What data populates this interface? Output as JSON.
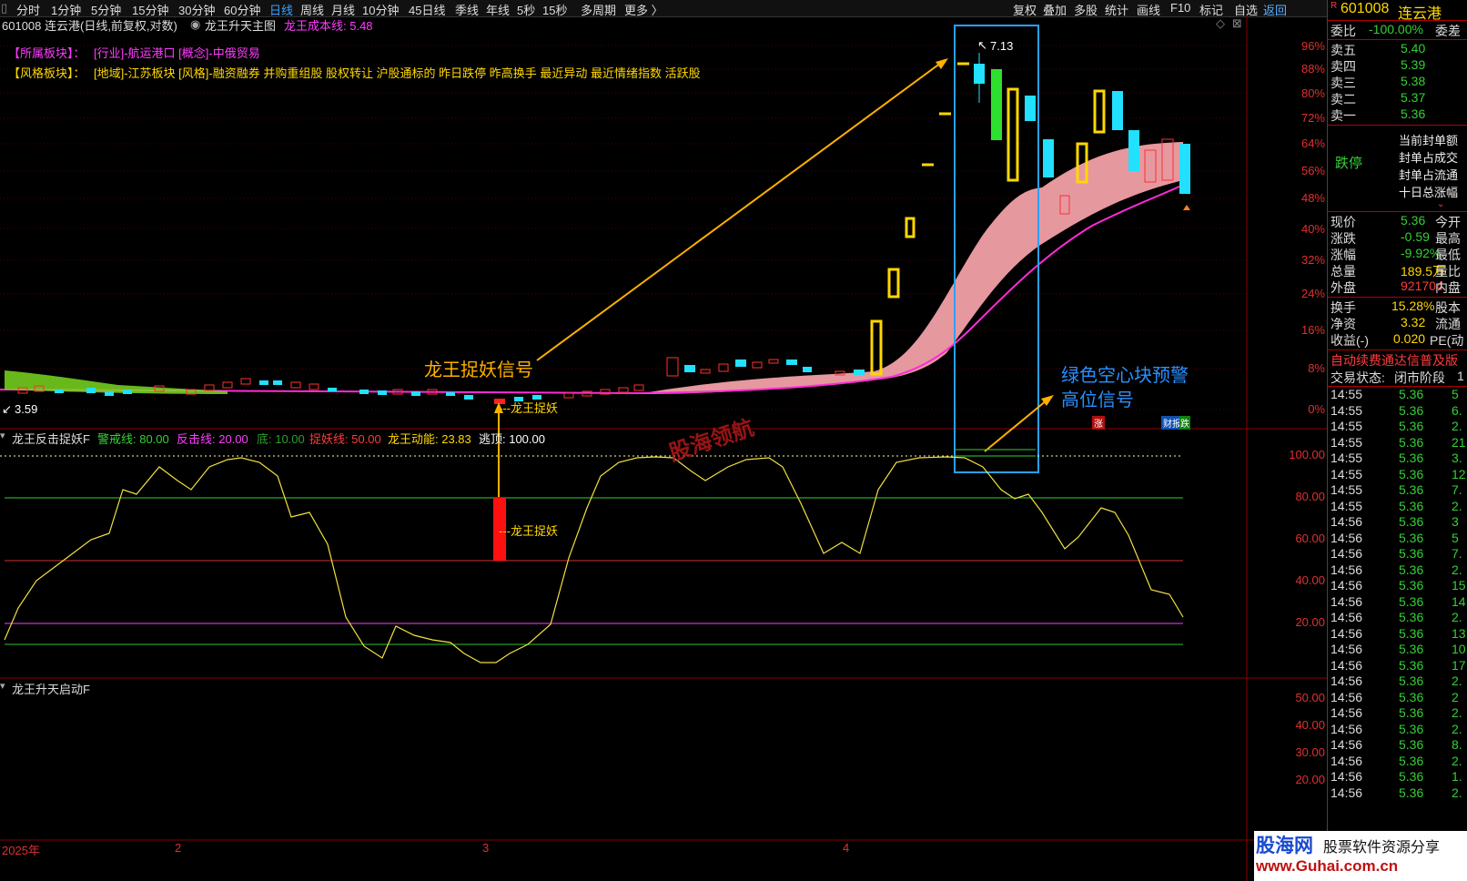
{
  "toolbar": {
    "periods": [
      "分时",
      "1分钟",
      "5分钟",
      "15分钟",
      "30分钟",
      "60分钟",
      "日线",
      "周线",
      "月线",
      "10分钟",
      "45日线",
      "季线",
      "年线",
      "5秒",
      "15秒",
      "多周期",
      "更多 〉"
    ],
    "active_period": "日线",
    "tools": [
      "复权",
      "叠加",
      "多股",
      "统计",
      "画线",
      "F10",
      "标记",
      "自选",
      "返回"
    ]
  },
  "chart_header": {
    "code_name": "601008 连云港(日线,前复权,对数)",
    "indicator_name": "龙王升天主图",
    "indicator_value": "龙王成本线: 5.48"
  },
  "sector_info": {
    "row1_label": "【所属板块】：",
    "row1_values": "[行业]-航运港口 [概念]-中俄贸易",
    "row2_label": "【风格板块】：",
    "row2_values": "[地域]-江苏板块 [风格]-融资融券 并购重组股 股权转让 沪股通标的 昨日跌停 昨高换手 最近异动 最近情绪指数 活跃股"
  },
  "main_chart": {
    "high_label": "7.13",
    "low_label": "3.59",
    "y_ticks": [
      "96%",
      "88%",
      "80%",
      "72%",
      "64%",
      "56%",
      "48%",
      "40%",
      "32%",
      "24%",
      "16%",
      "8%",
      "0%"
    ],
    "annotation_signal": "龙王捉妖信号",
    "annotation_warning_line1": "绿色空心块预警",
    "annotation_warning_line2": "高位信号",
    "marker_dragon": "---龙王捉妖",
    "badge_zhang": "涨",
    "badge_caibao": "财报",
    "badge_die": "跌",
    "watermark_text": "股海领航"
  },
  "sub_chart1": {
    "title": "龙王反击捉妖F",
    "params": [
      {
        "label": "警戒线: 80.00",
        "color": "#35d035"
      },
      {
        "label": "反击线: 20.00",
        "color": "#ff3cff"
      },
      {
        "label": "底: 10.00",
        "color": "#2e9e2e"
      },
      {
        "label": "捉妖线: 50.00",
        "color": "#ff3b3b"
      },
      {
        "label": "龙王动能: 23.83",
        "color": "#ffd800"
      },
      {
        "label": "逃顶: 100.00",
        "color": "#ffffff"
      }
    ],
    "marker": "---龙王捉妖",
    "y_ticks": [
      "100.00",
      "80.00",
      "60.00",
      "40.00",
      "20.00"
    ]
  },
  "sub_chart2": {
    "title": "龙王升天启动F",
    "y_ticks": [
      "50.00",
      "40.00",
      "30.00",
      "20.00"
    ]
  },
  "x_axis": {
    "labels": [
      "2025年",
      "2",
      "3",
      "4"
    ]
  },
  "chart_data": {
    "type": "candlestick",
    "y_scale": "log",
    "price_high": 7.13,
    "price_low": 3.59,
    "cost_line": 5.48,
    "indicator_levels": {
      "warning": 80,
      "counter": 20,
      "bottom": 10,
      "catch": 50,
      "escape": 100,
      "momentum": 23.83
    }
  },
  "panel": {
    "code": "601008",
    "name": "连云港",
    "r_mark": "R",
    "weibi_label": "委比",
    "weibi_value": "-100.00%",
    "weicha_label": "委差",
    "asks": [
      {
        "label": "卖五",
        "value": "5.40"
      },
      {
        "label": "卖四",
        "value": "5.39"
      },
      {
        "label": "卖三",
        "value": "5.38"
      },
      {
        "label": "卖二",
        "value": "5.37"
      },
      {
        "label": "卖一",
        "value": "5.36"
      }
    ],
    "limit_status": "跌停",
    "limit_details": [
      "当前封单额",
      "封单占成交",
      "封单占流通",
      "十日总涨幅"
    ],
    "quotes": [
      {
        "label": "现价",
        "value": "5.36",
        "extra": "今开"
      },
      {
        "label": "涨跌",
        "value": "-0.59",
        "extra": "最高"
      },
      {
        "label": "涨幅",
        "value": "-9.92%",
        "extra": "最低"
      },
      {
        "label": "总量",
        "value": "189.5万",
        "extra": "量比"
      },
      {
        "label": "外盘",
        "value": "921704",
        "extra": "内盘"
      }
    ],
    "stats": [
      {
        "label": "换手",
        "value": "15.28%",
        "extra": "股本"
      },
      {
        "label": "净资",
        "value": "3.32",
        "extra": "流通"
      },
      {
        "label": "收益(-)",
        "value": "0.020",
        "extra": "PE(动"
      }
    ],
    "banner": "自动续费通达信普及版",
    "trade_status_label": "交易状态:",
    "trade_status_value": "闭市阶段",
    "trade_status_extra": "1",
    "ticks": [
      {
        "time": "14:55",
        "price": "5.36",
        "vol": "5"
      },
      {
        "time": "14:55",
        "price": "5.36",
        "vol": "6."
      },
      {
        "time": "14:55",
        "price": "5.36",
        "vol": "2."
      },
      {
        "time": "14:55",
        "price": "5.36",
        "vol": "21."
      },
      {
        "time": "14:55",
        "price": "5.36",
        "vol": "3."
      },
      {
        "time": "14:55",
        "price": "5.36",
        "vol": "12."
      },
      {
        "time": "14:55",
        "price": "5.36",
        "vol": "7."
      },
      {
        "time": "14:55",
        "price": "5.36",
        "vol": "2."
      },
      {
        "time": "14:56",
        "price": "5.36",
        "vol": "3"
      },
      {
        "time": "14:56",
        "price": "5.36",
        "vol": "5"
      },
      {
        "time": "14:56",
        "price": "5.36",
        "vol": "7."
      },
      {
        "time": "14:56",
        "price": "5.36",
        "vol": "2."
      },
      {
        "time": "14:56",
        "price": "5.36",
        "vol": "15."
      },
      {
        "time": "14:56",
        "price": "5.36",
        "vol": "14."
      },
      {
        "time": "14:56",
        "price": "5.36",
        "vol": "2."
      },
      {
        "time": "14:56",
        "price": "5.36",
        "vol": "13."
      },
      {
        "time": "14:56",
        "price": "5.36",
        "vol": "10."
      },
      {
        "time": "14:56",
        "price": "5.36",
        "vol": "17."
      },
      {
        "time": "14:56",
        "price": "5.36",
        "vol": "2."
      },
      {
        "time": "14:56",
        "price": "5.36",
        "vol": "2"
      },
      {
        "time": "14:56",
        "price": "5.36",
        "vol": "2."
      },
      {
        "time": "14:56",
        "price": "5.36",
        "vol": "2."
      },
      {
        "time": "14:56",
        "price": "5.36",
        "vol": "8."
      },
      {
        "time": "14:56",
        "price": "5.36",
        "vol": "2."
      },
      {
        "time": "14:56",
        "price": "5.36",
        "vol": "1."
      },
      {
        "time": "14:56",
        "price": "5.36",
        "vol": "2."
      }
    ]
  },
  "site_watermark": {
    "title": "股海网",
    "subtitle": "股票软件资源分享",
    "url": "www.Guhai.com.cn"
  }
}
